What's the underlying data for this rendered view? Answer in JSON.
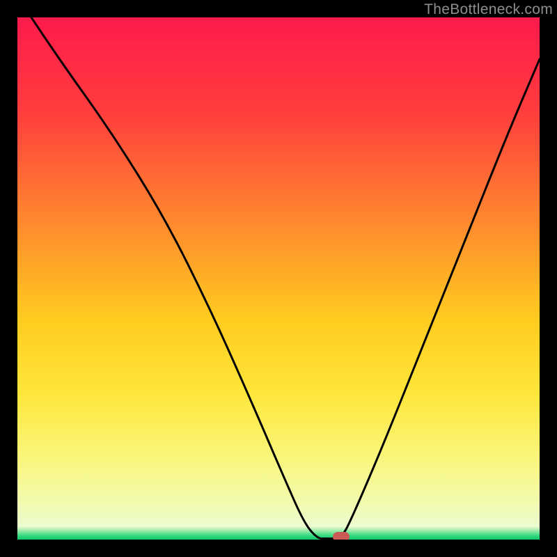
{
  "watermark": "TheBottleneck.com",
  "chart_data": {
    "type": "line",
    "title": "",
    "xlabel": "",
    "ylabel": "",
    "xlim": [
      0,
      100
    ],
    "ylim": [
      0,
      100
    ],
    "series": [
      {
        "name": "bottleneck-curve",
        "x": [
          0,
          8,
          18,
          28,
          37,
          45,
          51,
          55,
          57.5,
          59,
          62,
          64,
          70,
          78,
          86,
          94,
          100
        ],
        "y": [
          104,
          92,
          78,
          62,
          44,
          26,
          12,
          3,
          0.2,
          0.2,
          0.2,
          4,
          18,
          38,
          58,
          78,
          92
        ]
      }
    ],
    "marker": {
      "x": 62,
      "y": 0.6,
      "color": "#cc5a57"
    },
    "gradient_stops": [
      {
        "pos": 0,
        "color": "#ff1a4c"
      },
      {
        "pos": 0.18,
        "color": "#ff3d3d"
      },
      {
        "pos": 0.4,
        "color": "#ff8c2e"
      },
      {
        "pos": 0.58,
        "color": "#ffcc1f"
      },
      {
        "pos": 0.72,
        "color": "#ffe63a"
      },
      {
        "pos": 0.84,
        "color": "#faf67a"
      },
      {
        "pos": 0.92,
        "color": "#f3faa8"
      },
      {
        "pos": 1.0,
        "color": "#e8fce0"
      }
    ],
    "green_band": {
      "stops": [
        {
          "pos": 0,
          "color": "#dff7c8"
        },
        {
          "pos": 0.35,
          "color": "#8de9a4"
        },
        {
          "pos": 0.7,
          "color": "#2fd97e"
        },
        {
          "pos": 1.0,
          "color": "#12c566"
        }
      ],
      "height_pct": 2.4
    }
  }
}
